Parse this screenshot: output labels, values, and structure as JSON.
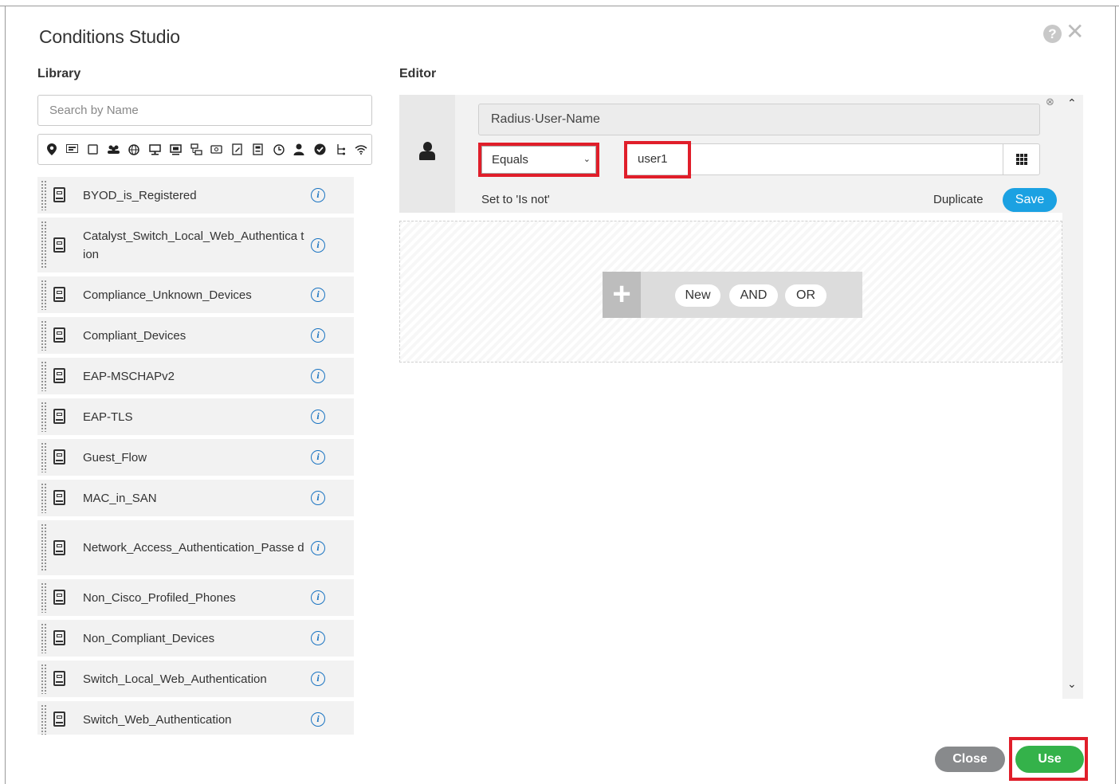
{
  "dialog": {
    "title": "Conditions Studio",
    "help_icon": "question-icon",
    "close_icon": "close-icon"
  },
  "library": {
    "label": "Library",
    "search_placeholder": "Search by Name",
    "filter_icons": [
      "location-icon",
      "tag-icon",
      "square-icon",
      "users-icon",
      "globe-icon",
      "monitor-icon",
      "desktop-icon",
      "network-icon",
      "router-icon",
      "edit-doc-icon",
      "document-icon",
      "clock-icon",
      "user-icon",
      "check-circle-icon",
      "tree-icon",
      "wifi-icon"
    ],
    "items": [
      {
        "name": "BYOD_is_Registered"
      },
      {
        "name": "Catalyst_Switch_Local_Web_Authentica tion"
      },
      {
        "name": "Compliance_Unknown_Devices"
      },
      {
        "name": "Compliant_Devices"
      },
      {
        "name": "EAP-MSCHAPv2"
      },
      {
        "name": "EAP-TLS"
      },
      {
        "name": "Guest_Flow"
      },
      {
        "name": "MAC_in_SAN"
      },
      {
        "name": "Network_Access_Authentication_Passe d"
      },
      {
        "name": "Non_Cisco_Profiled_Phones"
      },
      {
        "name": "Non_Compliant_Devices"
      },
      {
        "name": "Switch_Local_Web_Authentication"
      },
      {
        "name": "Switch_Web_Authentication"
      }
    ]
  },
  "editor": {
    "label": "Editor",
    "attribute": "Radius·User-Name",
    "operator": "Equals",
    "value": "user1",
    "set_not": "Set to 'Is not'",
    "duplicate": "Duplicate",
    "save": "Save",
    "add_new": "New",
    "add_and": "AND",
    "add_or": "OR"
  },
  "footer": {
    "close": "Close",
    "use": "Use"
  },
  "colors": {
    "save_blue": "#1ba1e2",
    "use_green": "#34b24a",
    "highlight_red": "#e01e2a",
    "info_blue": "#1a74c2"
  }
}
